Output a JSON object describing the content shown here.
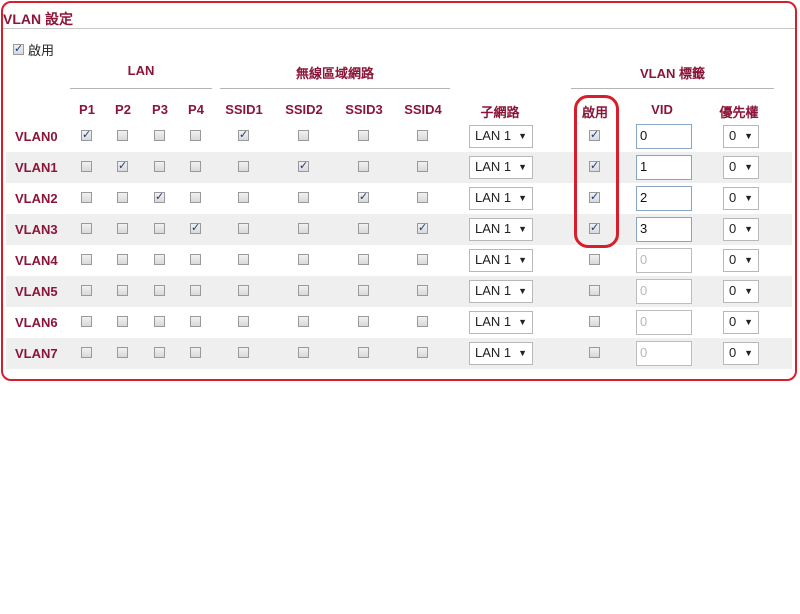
{
  "title": "VLAN 設定",
  "master_enable": {
    "label": "啟用",
    "checked": true
  },
  "groups": {
    "lan": "LAN",
    "wireless": "無線區域網路",
    "tag": "VLAN 標籤"
  },
  "headers": {
    "p1": "P1",
    "p2": "P2",
    "p3": "P3",
    "p4": "P4",
    "ssid1": "SSID1",
    "ssid2": "SSID2",
    "ssid3": "SSID3",
    "ssid4": "SSID4",
    "subnet": "子網路",
    "enable": "啟用",
    "vid": "VID",
    "priority": "優先權"
  },
  "rows": [
    {
      "name": "VLAN0",
      "ports": [
        true,
        false,
        false,
        false
      ],
      "ssids": [
        true,
        false,
        false,
        false
      ],
      "subnet": "LAN 1",
      "tag_enabled": true,
      "vid": "0",
      "priority": "0"
    },
    {
      "name": "VLAN1",
      "ports": [
        false,
        true,
        false,
        false
      ],
      "ssids": [
        false,
        true,
        false,
        false
      ],
      "subnet": "LAN 1",
      "tag_enabled": true,
      "vid": "1",
      "priority": "0"
    },
    {
      "name": "VLAN2",
      "ports": [
        false,
        false,
        true,
        false
      ],
      "ssids": [
        false,
        false,
        true,
        false
      ],
      "subnet": "LAN 1",
      "tag_enabled": true,
      "vid": "2",
      "priority": "0"
    },
    {
      "name": "VLAN3",
      "ports": [
        false,
        false,
        false,
        true
      ],
      "ssids": [
        false,
        false,
        false,
        true
      ],
      "subnet": "LAN 1",
      "tag_enabled": true,
      "vid": "3",
      "priority": "0"
    },
    {
      "name": "VLAN4",
      "ports": [
        false,
        false,
        false,
        false
      ],
      "ssids": [
        false,
        false,
        false,
        false
      ],
      "subnet": "LAN 1",
      "tag_enabled": false,
      "vid": "0",
      "priority": "0"
    },
    {
      "name": "VLAN5",
      "ports": [
        false,
        false,
        false,
        false
      ],
      "ssids": [
        false,
        false,
        false,
        false
      ],
      "subnet": "LAN 1",
      "tag_enabled": false,
      "vid": "0",
      "priority": "0"
    },
    {
      "name": "VLAN6",
      "ports": [
        false,
        false,
        false,
        false
      ],
      "ssids": [
        false,
        false,
        false,
        false
      ],
      "subnet": "LAN 1",
      "tag_enabled": false,
      "vid": "0",
      "priority": "0"
    },
    {
      "name": "VLAN7",
      "ports": [
        false,
        false,
        false,
        false
      ],
      "ssids": [
        false,
        false,
        false,
        false
      ],
      "subnet": "LAN 1",
      "tag_enabled": false,
      "vid": "0",
      "priority": "0"
    }
  ],
  "colors": {
    "accent": "#8b1538",
    "frame": "#d81e2a",
    "row_shade": "#efefef"
  },
  "icons": {
    "checkbox_check": "check-mark-icon",
    "dropdown": "chevron-down-icon"
  }
}
